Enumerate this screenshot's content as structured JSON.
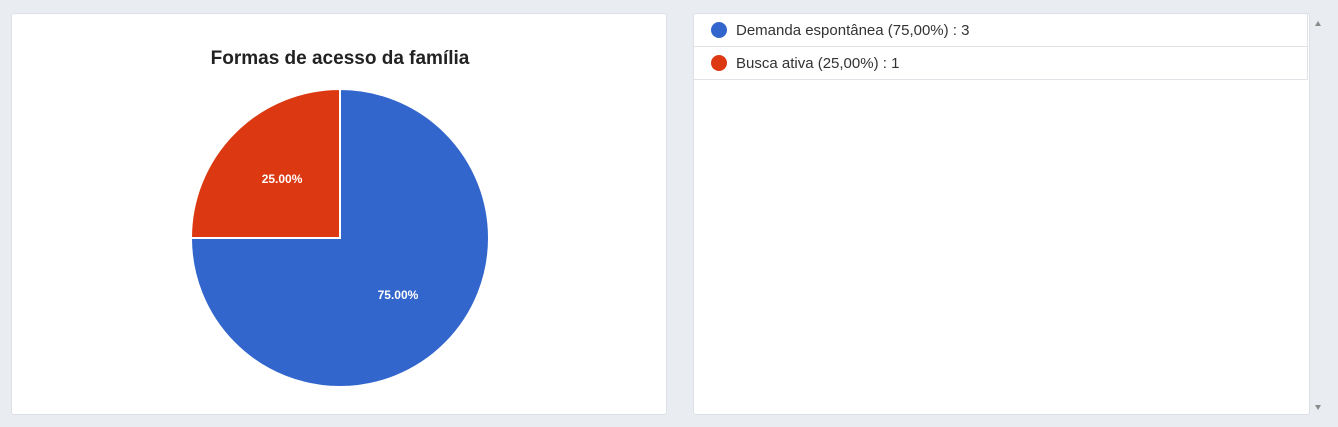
{
  "chart_data": {
    "type": "pie",
    "title": "Formas de acesso da família",
    "categories": [
      "Demanda espontânea",
      "Busca ativa"
    ],
    "values": [
      3,
      1
    ],
    "slice_labels": [
      "75.00%",
      "25.00%"
    ],
    "colors": [
      "#3366cc",
      "#dc3912"
    ],
    "legend_placement": "right"
  },
  "legend": {
    "items": [
      {
        "label": "Demanda espontânea (75,00%) : 3",
        "color": "#3366cc"
      },
      {
        "label": "Busca ativa (25,00%) : 1",
        "color": "#dc3912"
      }
    ]
  }
}
